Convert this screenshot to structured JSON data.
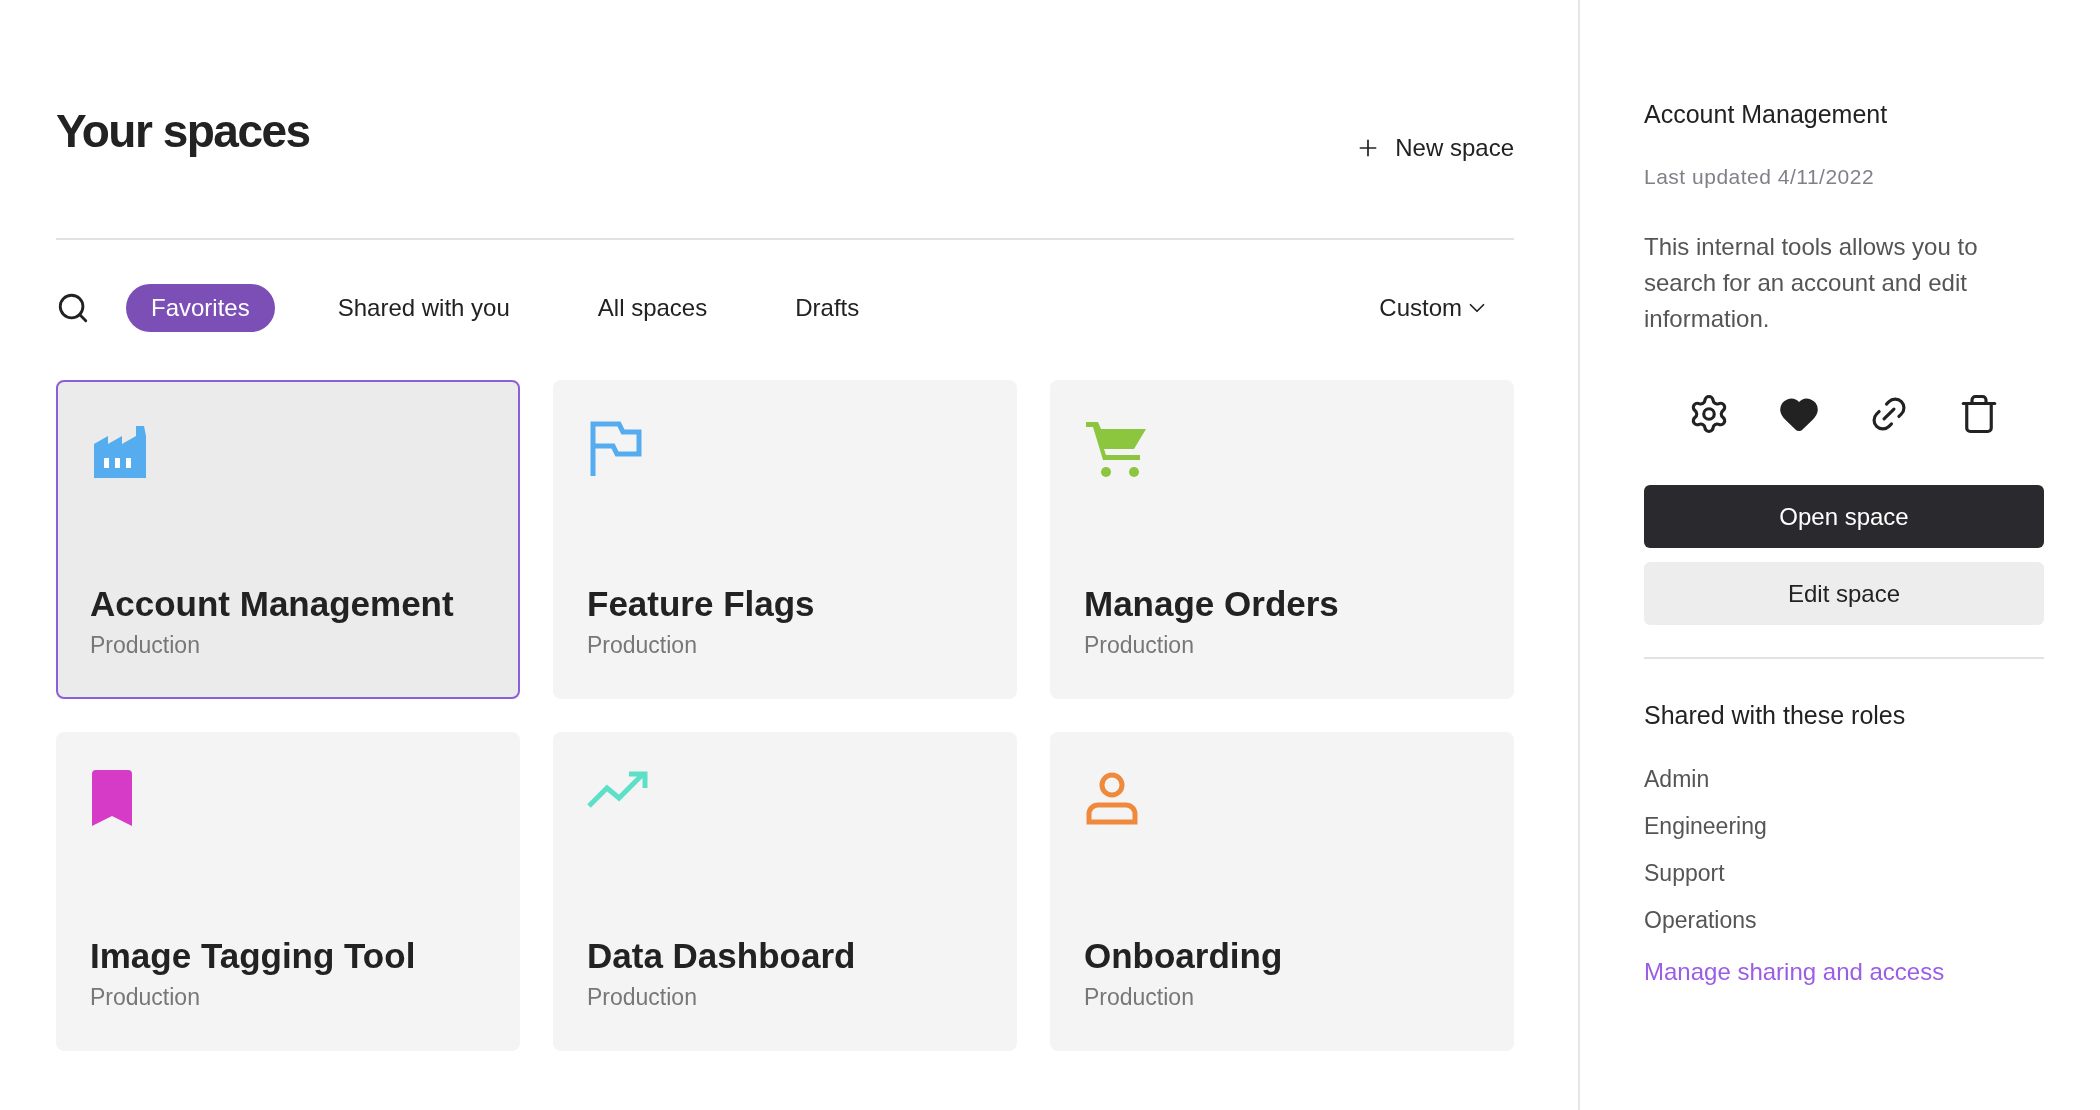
{
  "header": {
    "title": "Your spaces",
    "new_button": "New space"
  },
  "filters": {
    "tabs": [
      {
        "label": "Favorites",
        "selected": true
      },
      {
        "label": "Shared with you",
        "selected": false
      },
      {
        "label": "All spaces",
        "selected": false
      },
      {
        "label": "Drafts",
        "selected": false
      }
    ],
    "sort": "Custom"
  },
  "spaces": [
    {
      "name": "Account Management",
      "environment": "Production",
      "color": "#55acee",
      "selected": true
    },
    {
      "name": "Feature Flags",
      "environment": "Production",
      "color": "#55acee",
      "selected": false
    },
    {
      "name": "Manage Orders",
      "environment": "Production",
      "color": "#8cc63f",
      "selected": false
    },
    {
      "name": "Image Tagging Tool",
      "environment": "Production",
      "color": "#d63bc7",
      "selected": false
    },
    {
      "name": "Data Dashboard",
      "environment": "Production",
      "color": "#5ee0c8",
      "selected": false
    },
    {
      "name": "Onboarding",
      "environment": "Production",
      "color": "#ef8a3c",
      "selected": false
    }
  ],
  "details": {
    "title": "Account Management",
    "last_updated": "Last updated 4/11/2022",
    "description": "This internal tools allows you to search for an account and edit information.",
    "open_button": "Open space",
    "edit_button": "Edit space",
    "roles_title": "Shared with these roles",
    "roles": [
      "Admin",
      "Engineering",
      "Support",
      "Operations"
    ],
    "manage_link": "Manage sharing and access"
  }
}
